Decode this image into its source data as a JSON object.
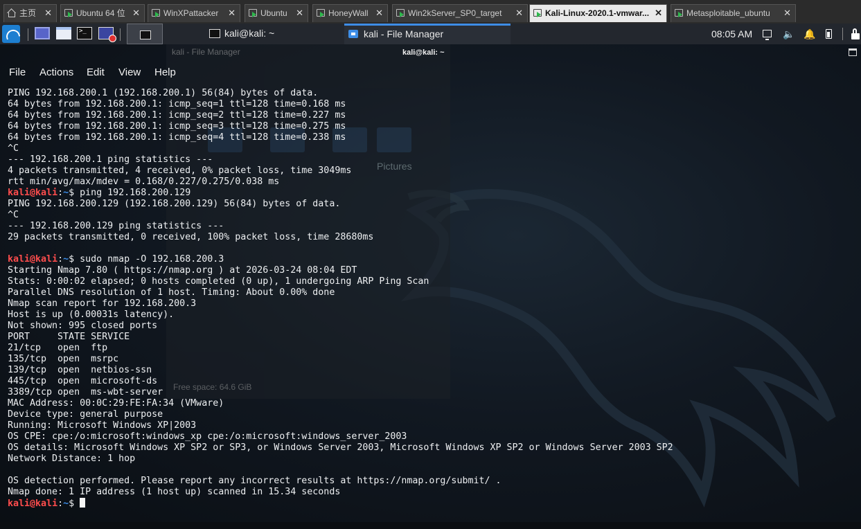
{
  "vm_tabs": [
    {
      "label": "主页",
      "type": "home",
      "active": false
    },
    {
      "label": "Ubuntu 64 位",
      "type": "vm",
      "active": false
    },
    {
      "label": "WinXPattacker",
      "type": "vm",
      "active": false
    },
    {
      "label": "Ubuntu",
      "type": "vm",
      "active": false
    },
    {
      "label": "HoneyWall",
      "type": "vm",
      "active": false
    },
    {
      "label": "Win2kServer_SP0_target",
      "type": "vm",
      "active": false
    },
    {
      "label": "Kali-Linux-2020.1-vmwar...",
      "type": "vm",
      "active": true
    },
    {
      "label": "Metasploitable_ubuntu",
      "type": "vm",
      "active": false
    }
  ],
  "tab_close_glyph": "✕",
  "panel": {
    "tasks": [
      {
        "label": "kali@kali: ~",
        "icon": "terminal-icon"
      },
      {
        "label": "kali - File Manager",
        "icon": "file-manager-icon",
        "active": true
      }
    ],
    "clock": "08:05 AM"
  },
  "file_manager_ghost": {
    "title": "kali - File Manager",
    "pictures_label": "Pictures",
    "status": "Free space: 64.6 GiB"
  },
  "terminal": {
    "title": "kali@kali: ~",
    "menu": [
      "File",
      "Actions",
      "Edit",
      "View",
      "Help"
    ],
    "prompt": {
      "user": "kali",
      "at": "@",
      "host": "kali",
      "colon": ":",
      "dir": "~",
      "symbol": "$"
    },
    "lines": [
      {
        "text": "PING 192.168.200.1 (192.168.200.1) 56(84) bytes of data."
      },
      {
        "text": "64 bytes from 192.168.200.1: icmp_seq=1 ttl=128 time=0.168 ms"
      },
      {
        "text": "64 bytes from 192.168.200.1: icmp_seq=2 ttl=128 time=0.227 ms"
      },
      {
        "text": "64 bytes from 192.168.200.1: icmp_seq=3 ttl=128 time=0.275 ms"
      },
      {
        "text": "64 bytes from 192.168.200.1: icmp_seq=4 ttl=128 time=0.238 ms"
      },
      {
        "text": "^C"
      },
      {
        "text": "--- 192.168.200.1 ping statistics ---"
      },
      {
        "text": "4 packets transmitted, 4 received, 0% packet loss, time 3049ms"
      },
      {
        "text": "rtt min/avg/max/mdev = 0.168/0.227/0.275/0.038 ms"
      },
      {
        "prompt": true,
        "cmd": " ping 192.168.200.129"
      },
      {
        "text": "PING 192.168.200.129 (192.168.200.129) 56(84) bytes of data."
      },
      {
        "text": "^C"
      },
      {
        "text": "--- 192.168.200.129 ping statistics ---"
      },
      {
        "text": "29 packets transmitted, 0 received, 100% packet loss, time 28680ms"
      },
      {
        "text": ""
      },
      {
        "prompt": true,
        "cmd": " sudo nmap -O 192.168.200.3"
      },
      {
        "text": "Starting Nmap 7.80 ( https://nmap.org ) at 2026-03-24 08:04 EDT"
      },
      {
        "text": "Stats: 0:00:02 elapsed; 0 hosts completed (0 up), 1 undergoing ARP Ping Scan"
      },
      {
        "text": "Parallel DNS resolution of 1 host. Timing: About 0.00% done"
      },
      {
        "text": "Nmap scan report for 192.168.200.3"
      },
      {
        "text": "Host is up (0.00031s latency)."
      },
      {
        "text": "Not shown: 995 closed ports"
      },
      {
        "text": "PORT     STATE SERVICE"
      },
      {
        "text": "21/tcp   open  ftp"
      },
      {
        "text": "135/tcp  open  msrpc"
      },
      {
        "text": "139/tcp  open  netbios-ssn"
      },
      {
        "text": "445/tcp  open  microsoft-ds"
      },
      {
        "text": "3389/tcp open  ms-wbt-server"
      },
      {
        "text": "MAC Address: 00:0C:29:FE:FA:34 (VMware)"
      },
      {
        "text": "Device type: general purpose"
      },
      {
        "text": "Running: Microsoft Windows XP|2003"
      },
      {
        "text": "OS CPE: cpe:/o:microsoft:windows_xp cpe:/o:microsoft:windows_server_2003"
      },
      {
        "text": "OS details: Microsoft Windows XP SP2 or SP3, or Windows Server 2003, Microsoft Windows XP SP2 or Windows Server 2003 SP2"
      },
      {
        "text": "Network Distance: 1 hop"
      },
      {
        "text": ""
      },
      {
        "text": "OS detection performed. Please report any incorrect results at https://nmap.org/submit/ ."
      },
      {
        "text": "Nmap done: 1 IP address (1 host up) scanned in 15.34 seconds"
      },
      {
        "prompt": true,
        "cmd": " ",
        "cursor": true
      }
    ]
  },
  "colors": {
    "prompt_user": "#ff4d4d",
    "prompt_dir": "#3b8eea",
    "terminal_text": "#eef0f2",
    "accent": "#3d8de6"
  }
}
